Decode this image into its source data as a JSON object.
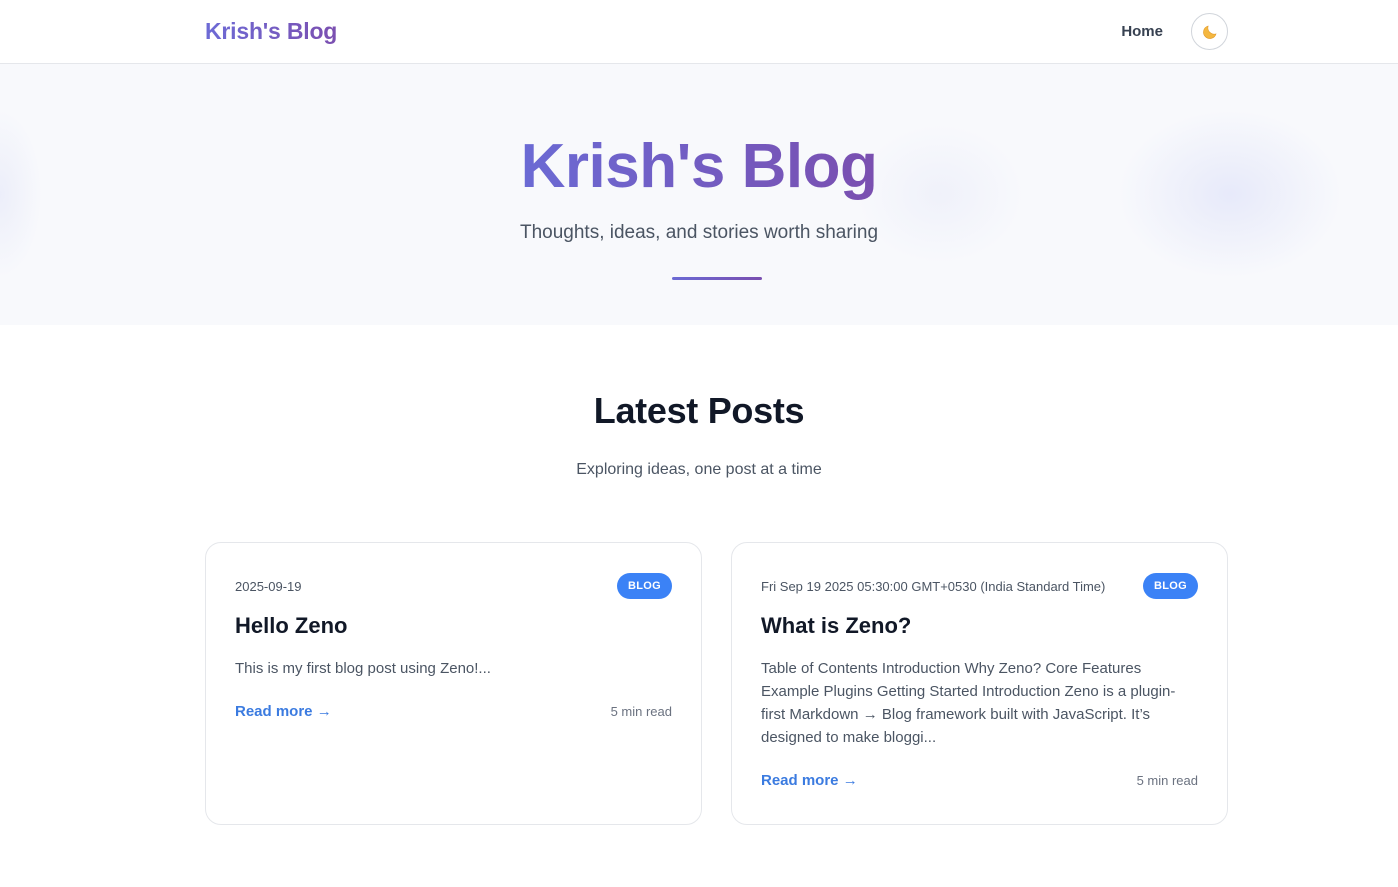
{
  "nav": {
    "brand": "Krish's Blog",
    "links": [
      {
        "label": "Home"
      }
    ],
    "theme_icon": "moon-icon"
  },
  "hero": {
    "title": "Krish's Blog",
    "subtitle": "Thoughts, ideas, and stories worth sharing"
  },
  "section": {
    "title": "Latest Posts",
    "subtitle": "Exploring ideas, one post at a time"
  },
  "posts": [
    {
      "date": "2025-09-19",
      "tag": "BLOG",
      "title": "Hello Zeno",
      "excerpt": "This is my first blog post using Zeno!...",
      "read_more": "Read more →",
      "read_time": "5 min read"
    },
    {
      "date": "Fri Sep 19 2025 05:30:00 GMT+0530 (India Standard Time)",
      "tag": "BLOG",
      "title": "What is Zeno?",
      "excerpt": "Table of Contents Introduction Why Zeno? Core Features Example Plugins Getting Started Introduction Zeno is a plugin-first Markdown → Blog framework built with JavaScript. It’s designed to make bloggi...",
      "read_more": "Read more →",
      "read_time": "5 min read"
    }
  ],
  "colors": {
    "accent": "#6d6bd6",
    "accent_end": "#7b4fb0",
    "tag": "#3b82f6",
    "link": "#3b7be0"
  }
}
